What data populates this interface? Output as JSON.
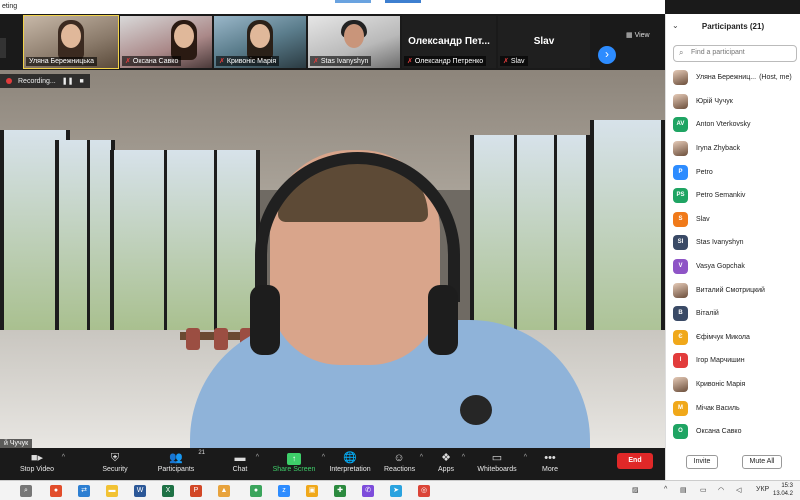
{
  "window": {
    "title": "eting"
  },
  "strip": {
    "thumbnails": [
      {
        "name": "Уляна Бережницька",
        "muted": false
      },
      {
        "name": "Оксана Савко",
        "muted": true
      },
      {
        "name": "Кривоніс Марія",
        "muted": true
      },
      {
        "name": "Stas Ivanyshyn",
        "muted": true
      },
      {
        "name": "Олександр Петренко",
        "muted": true,
        "display_name": "Олександр Пет..."
      },
      {
        "name": "Slav",
        "muted": true,
        "display_name": "Slav"
      }
    ],
    "view_label": "View",
    "next_icon": "chevron-right-icon"
  },
  "main": {
    "recording_label": "Recording...",
    "speaker_name": "й Чучук"
  },
  "toolbar": {
    "stop_video": "Stop Video",
    "security": "Security",
    "participants": "Participants",
    "participants_count": "21",
    "chat": "Chat",
    "share_screen": "Share Screen",
    "interpretation": "Interpretation",
    "reactions": "Reactions",
    "apps": "Apps",
    "whiteboards": "Whiteboards",
    "more": "More",
    "end": "End",
    "share_color": "#3ecf6a",
    "end_color": "#e02828"
  },
  "panel": {
    "title": "Participants (21)",
    "search_placeholder": "Find a participant",
    "invite": "Invite",
    "mute_all": "Mute All",
    "participants": [
      {
        "name": "Уляна Бережниц...",
        "note": "(Host, me)",
        "avatar": "",
        "color": "photo"
      },
      {
        "name": "Юрій Чучук",
        "avatar": "",
        "color": "photo"
      },
      {
        "name": "Anton Vterkovsky",
        "avatar": "AV",
        "color": "#1fa463"
      },
      {
        "name": "Iryna Zhyback",
        "avatar": "",
        "color": "photo"
      },
      {
        "name": "Petro",
        "avatar": "P",
        "color": "#2d8cff"
      },
      {
        "name": "Petro Semankiv",
        "avatar": "PS",
        "color": "#1fa463"
      },
      {
        "name": "Slav",
        "avatar": "S",
        "color": "#f07a1a"
      },
      {
        "name": "Stas Ivanyshyn",
        "avatar": "SI",
        "color": "#3a4a66"
      },
      {
        "name": "Vasya Gopchak",
        "avatar": "V",
        "color": "#8e54c6"
      },
      {
        "name": "Виталий Смотрицкий",
        "avatar": "",
        "color": "photo"
      },
      {
        "name": "Віталій",
        "avatar": "В",
        "color": "#3a4a66"
      },
      {
        "name": "Єфімчук Микола",
        "avatar": "Є",
        "color": "#f0a81a"
      },
      {
        "name": "Ігор Марчишин",
        "avatar": "І",
        "color": "#e23c3c"
      },
      {
        "name": "Кривоніс Марія",
        "avatar": "",
        "color": "photo"
      },
      {
        "name": "Мічак Василь",
        "avatar": "М",
        "color": "#f0a81a"
      },
      {
        "name": "Оксана Савко",
        "avatar": "О",
        "color": "#1fa463"
      }
    ]
  },
  "taskbar": {
    "language": "УКР",
    "time": "15:3",
    "date": "13.04.2"
  }
}
